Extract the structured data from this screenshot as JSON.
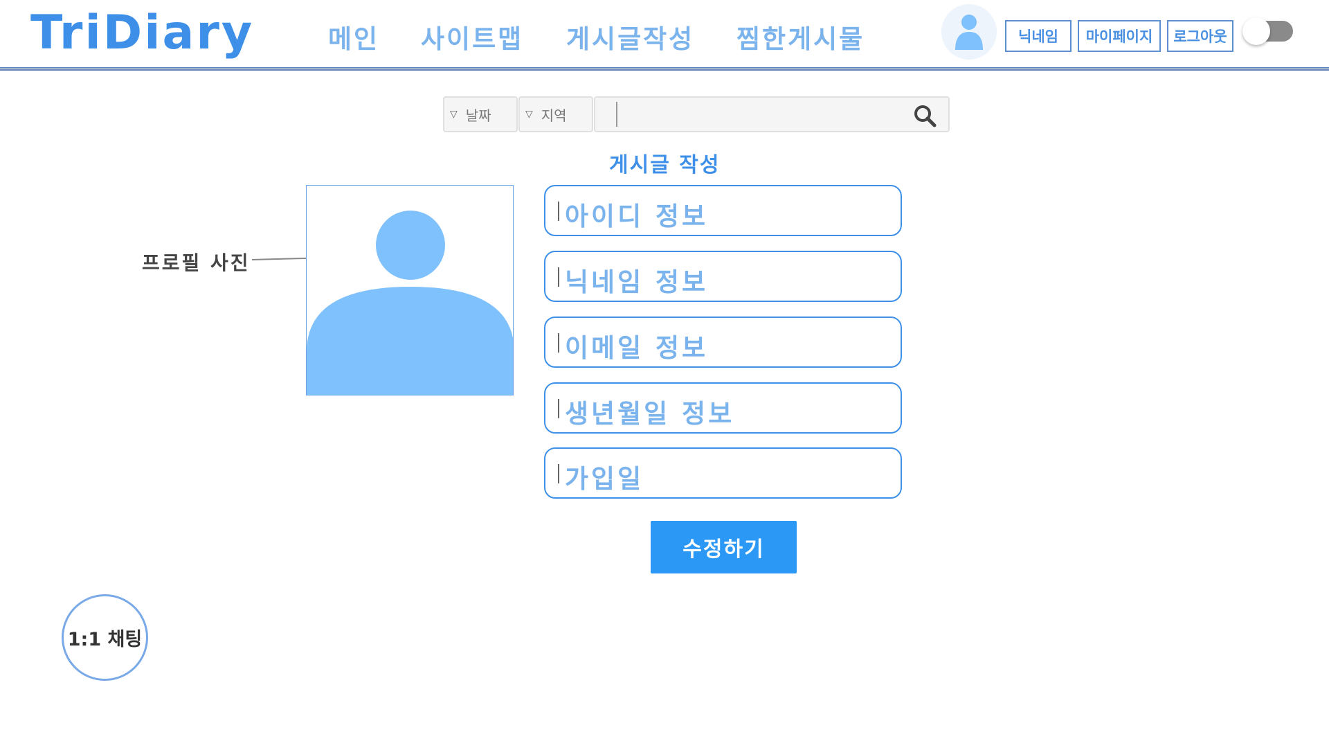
{
  "header": {
    "logo": "TriDiary",
    "nav": [
      "메인",
      "사이트맵",
      "게시글작성",
      "찜한게시물"
    ],
    "buttons": {
      "nickname": "닉네임",
      "mypage": "마이페이지",
      "logout": "로그아웃"
    }
  },
  "search": {
    "date_label": "날짜",
    "region_label": "지역",
    "placeholder": ""
  },
  "section_title": "게시글 작성",
  "profile": {
    "label": "프로필 사진"
  },
  "fields": [
    "아이디 정보",
    "닉네임 정보",
    "이메일 정보",
    "생년월일 정보",
    "가입일"
  ],
  "submit_label": "수정하기",
  "chat_label": "1:1 채팅",
  "colors": {
    "brand": "#3d8fe8",
    "nav_text": "#7bb3ec",
    "avatar": "#7fc1fc",
    "submit": "#2b98f5"
  },
  "icons": [
    "user-icon",
    "search-icon",
    "toggle-switch",
    "profile-placeholder-icon"
  ]
}
